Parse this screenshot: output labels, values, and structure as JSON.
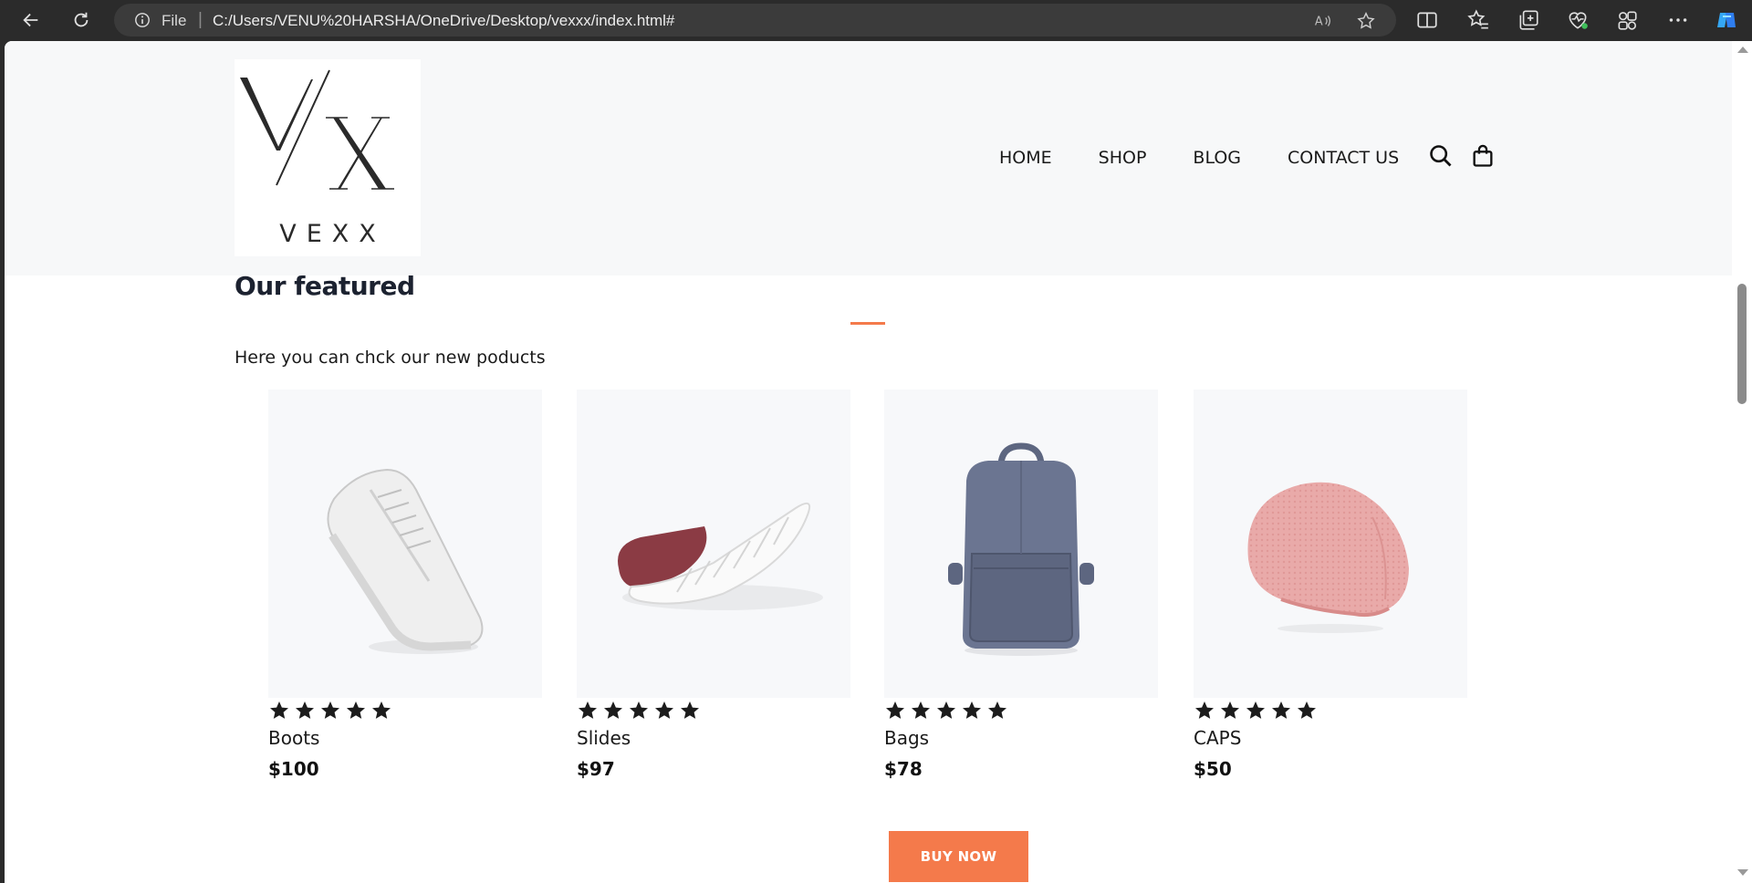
{
  "browser": {
    "address_prefix": "File",
    "url": "C:/Users/VENU%20HARSHA/OneDrive/Desktop/vexxx/index.html#"
  },
  "site": {
    "logo_word": "VEXX",
    "nav": [
      "HOME",
      "SHOP",
      "BLOG",
      "CONTACT US"
    ]
  },
  "featured": {
    "title": "Our featured",
    "subtitle": "Here you can chck our new poducts",
    "accent_color": "#f47a4b",
    "products": [
      {
        "name": "Boots",
        "price": "$100",
        "rating": 5,
        "image": "white-sneaker"
      },
      {
        "name": "Slides",
        "price": "$97",
        "rating": 5,
        "image": "maroon-slip-on-shoe"
      },
      {
        "name": "Bags",
        "price": "$78",
        "rating": 5,
        "image": "blue-leather-backpack"
      },
      {
        "name": "CAPS",
        "price": "$50",
        "rating": 5,
        "image": "pink-beanie"
      }
    ],
    "buy_label": "BUY NOW"
  }
}
